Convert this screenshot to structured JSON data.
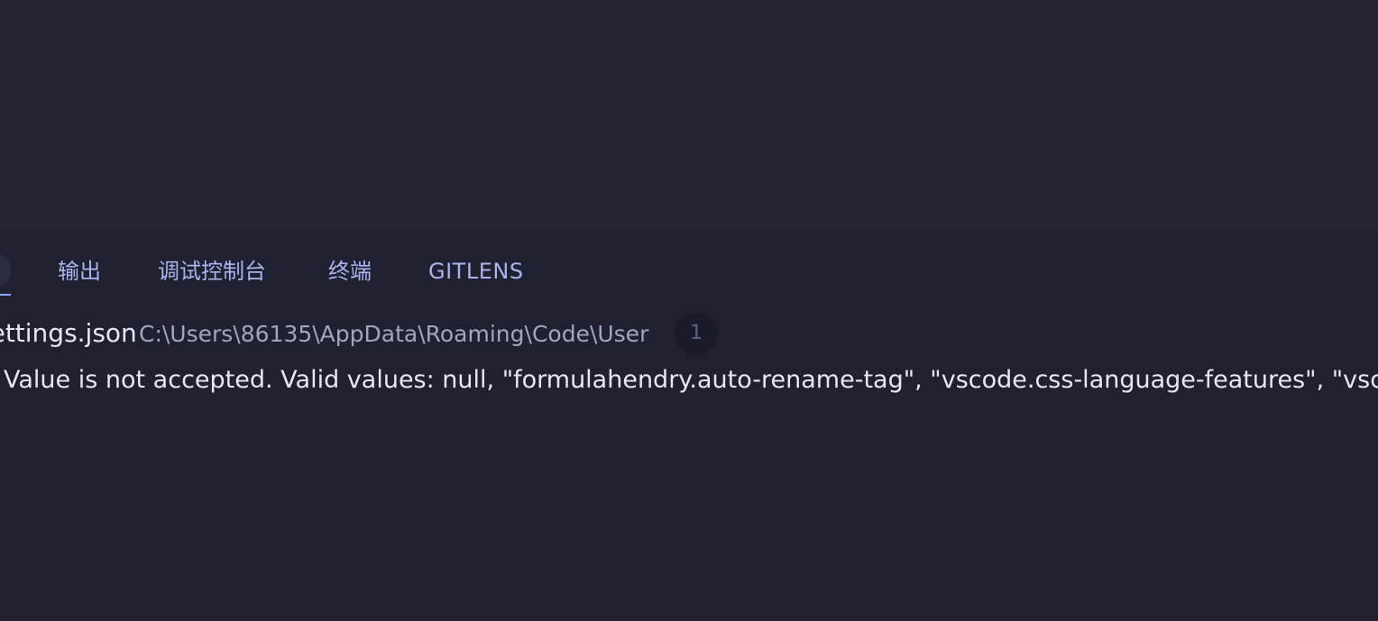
{
  "panel": {
    "tabs": [
      {
        "label": "输出"
      },
      {
        "label": "调试控制台"
      },
      {
        "label": "终端"
      },
      {
        "label": "GITLENS"
      }
    ]
  },
  "problems": {
    "file": {
      "name": "settings.json",
      "path": "C:\\Users\\86135\\AppData\\Roaming\\Code\\User",
      "count": "1"
    },
    "items": [
      {
        "message": "Value is not accepted. Valid values: null, \"formulahendry.auto-rename-tag\", \"vscode.css-language-features\", \"vscode"
      }
    ]
  },
  "colors": {
    "editor_bg": "#232535",
    "panel_bg": "#1f2130",
    "tab_text": "#a9b4ef",
    "active_underline": "#8aa6ff",
    "text": "#e4e7f5",
    "muted_text": "#a0a6bd"
  }
}
